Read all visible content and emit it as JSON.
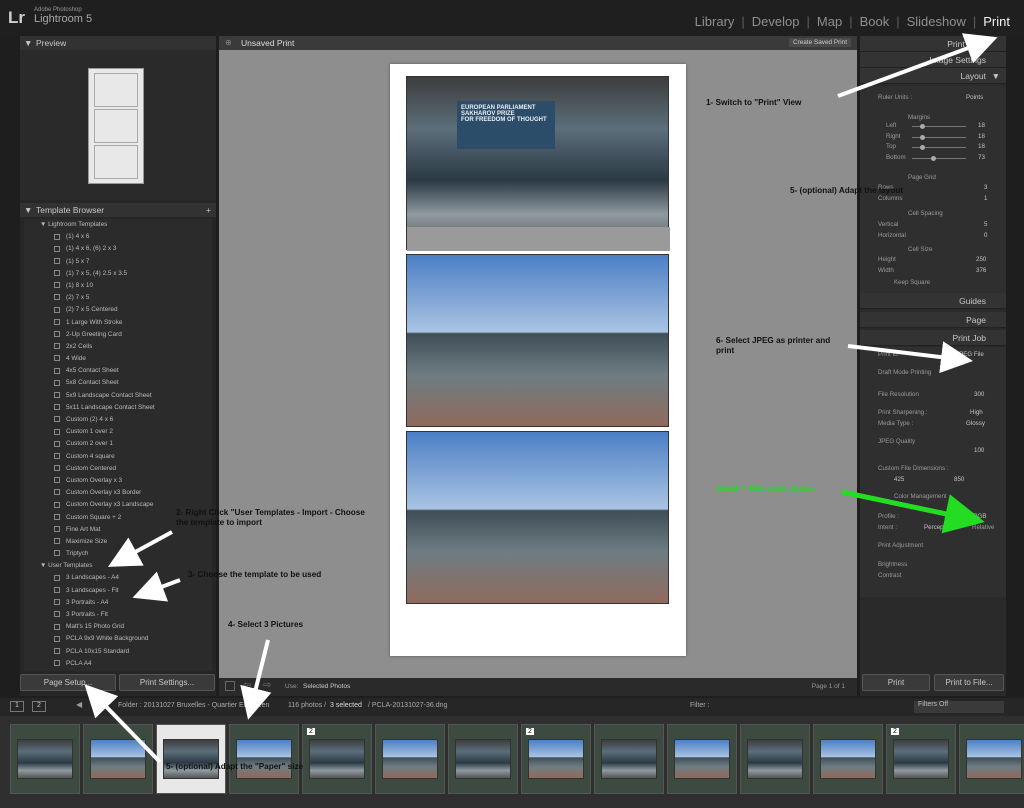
{
  "app": {
    "vendor": "Adobe Photoshop",
    "product": "Lightroom 5",
    "logo": "Lr"
  },
  "modules": [
    "Library",
    "Develop",
    "Map",
    "Book",
    "Slideshow",
    "Print"
  ],
  "active_module": "Print",
  "left": {
    "preview_title": "Preview",
    "template_browser_title": "Template Browser",
    "lightroom_templates_title": "Lightroom Templates",
    "lightroom_templates": [
      "(1) 4 x 6",
      "(1) 4 x 6, (6) 2 x 3",
      "(1) 5 x 7",
      "(1) 7 x 5, (4) 2.5 x 3.5",
      "(1) 8 x 10",
      "(2) 7 x 5",
      "(2) 7 x 5 Centered",
      "1 Large With Stroke",
      "2-Up Greeting Card",
      "2x2 Cells",
      "4 Wide",
      "4x5 Contact Sheet",
      "5x8 Contact Sheet",
      "5x9 Landscape Contact Sheet",
      "5x11 Landscape Contact Sheet",
      "Custom (2) 4 x 6",
      "Custom 1 over 2",
      "Custom 2 over 1",
      "Custom 4 square",
      "Custom Centered",
      "Custom Overlay x 3",
      "Custom Overlay x3 Border",
      "Custom Overlay x3 Landscape",
      "Custom Square + 2",
      "Fine Art Mat",
      "Maximize Size",
      "Triptych"
    ],
    "user_templates_title": "User Templates",
    "user_templates": [
      "3 Landscapes - A4",
      "3 Landscapes - Fit",
      "3 Portraits - A4",
      "3 Portraits - Fit",
      "Matt's 15 Photo Grid",
      "PCLA 9x9 White Background",
      "PCLA 10x15 Standard",
      "PCLA A4"
    ],
    "page_setup": "Page Setup...",
    "print_settings": "Print Settings..."
  },
  "center": {
    "title": "Unsaved Print",
    "create_saved_print": "Create Saved Print",
    "use_label": "Use:",
    "use_value": "Selected Photos",
    "page_indicator": "Page 1 of 1"
  },
  "right": {
    "sections": {
      "print_style": "Print Style",
      "image_settings": "Image Settings",
      "layout": "Layout",
      "guides": "Guides",
      "page": "Page",
      "print_job": "Print Job"
    },
    "ruler_units_label": "Ruler Units :",
    "ruler_units_value": "Points",
    "margins_title": "Margins",
    "margins": [
      {
        "label": "Left",
        "value": "18"
      },
      {
        "label": "Right",
        "value": "18"
      },
      {
        "label": "Top",
        "value": "18"
      },
      {
        "label": "Bottom",
        "value": "73"
      }
    ],
    "margins_fill": [
      0.15,
      0.15,
      0.15,
      0.35
    ],
    "margins_unit": "pt",
    "page_grid_title": "Page Grid",
    "rows_label": "Rows",
    "rows_value": "3",
    "columns_label": "Columns",
    "columns_value": "1",
    "cell_spacing_title": "Cell Spacing",
    "vertical_label": "Vertical",
    "vertical_value": "5",
    "horizontal_label": "Horizontal",
    "horizontal_value": "0",
    "cell_size_title": "Cell Size",
    "height_label": "Height",
    "height_value": "250",
    "width_label": "Width",
    "width_value": "376",
    "keep_square": "Keep Square",
    "print_to_label": "Print to:",
    "print_to_value": "JPEG File",
    "draft_mode": "Draft Mode Printing",
    "file_resolution_label": "File Resolution",
    "file_resolution_value": "300",
    "ppi": "ppi",
    "print_sharpening_label": "Print Sharpening :",
    "print_sharpening_value": "High",
    "media_type_label": "Media Type :",
    "media_type_value": "Glossy",
    "jpeg_quality_label": "JPEG Quality",
    "jpeg_quality_value": "100",
    "custom_file_dims": "Custom File Dimensions :",
    "dim_w": "425",
    "dim_h": "850",
    "color_mgmt_title": "Color Management",
    "profile_label": "Profile :",
    "profile_value": "sRGB",
    "intent_label": "Intent :",
    "intent_perceptual": "Perceptual",
    "intent_relative": "Relative",
    "print_adjustment": "Print Adjustment",
    "brightness_label": "Brightness",
    "contrast_label": "Contrast",
    "print_button": "Print",
    "print_to_file_button": "Print to File..."
  },
  "filmstrip_bar": {
    "pages": [
      "1",
      "2"
    ],
    "folder": "Folder : 20131027 Bruxelles - Quartier Européen",
    "count": "116 photos /",
    "selected": "3 selected",
    "file": "/ PCLA-20131027-36.dng",
    "filter_label": "Filter :",
    "filter_value": "Filters Off"
  },
  "thumb_badges": [
    "2",
    "2",
    "2"
  ],
  "annotations": {
    "a1": "1- Switch to \"Print\" View",
    "a2": "2- Right Click \"User Templates - Import - Choose the template to import",
    "a3": "3- Choose the template to be used",
    "a4": "4- Select 3 Pictures",
    "a5": "5- (optional) Adapt the layout",
    "a5b": "5- (optional) Adapt the \"Paper\" size",
    "a6": "6- Select JPEG as printer and print",
    "a7": "sRGB = Web color space"
  },
  "colors": {
    "annotation_arrow": "#ffffff",
    "annotation_green": "#22dd22",
    "accent_module": "#f0f0f0"
  }
}
